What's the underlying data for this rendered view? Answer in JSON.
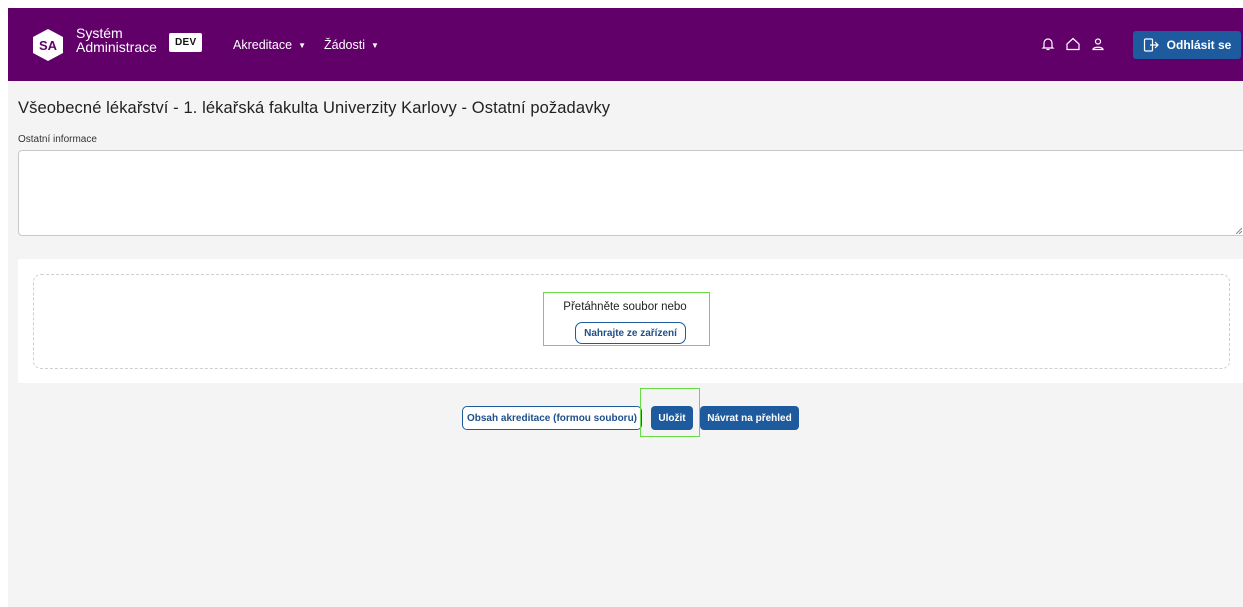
{
  "header": {
    "logo_text": "SA",
    "brand_line1": "Systém",
    "brand_line2": "Administrace",
    "env_badge": "DEV",
    "nav": [
      {
        "label": "Akreditace"
      },
      {
        "label": "Žádosti"
      }
    ],
    "icons": [
      "bell-icon",
      "home-icon",
      "user-icon"
    ],
    "logout_label": "Odhlásit se",
    "bg_color": "#62006a",
    "accent_color": "#1e5a9e"
  },
  "page": {
    "title": "Všeobecné lékařství - 1. lékařská fakulta Univerzity Karlovy - Ostatní požadavky",
    "field_label": "Ostatní informace",
    "textarea_value": ""
  },
  "upload": {
    "hint": "Přetáhněte soubor nebo",
    "button_label": "Nahrajte ze zařízení"
  },
  "actions": {
    "content_label": "Obsah akreditace (formou souboru)",
    "save_label": "Uložit",
    "back_label": "Návrat na přehled"
  }
}
